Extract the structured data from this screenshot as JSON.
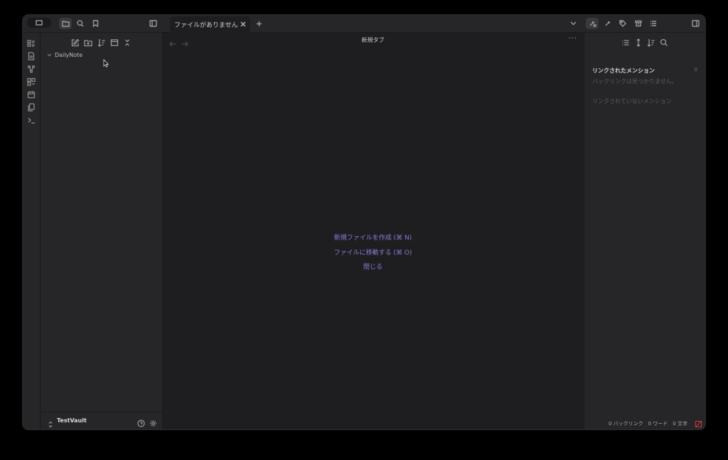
{
  "tab": {
    "title": "ファイルがありません"
  },
  "main": {
    "view_title": "新規タブ",
    "more_label": "···",
    "actions": {
      "new_file": "新規ファイルを作成 (⌘ N)",
      "go_to_file": "ファイルに移動する (⌘ O)",
      "close": "閉じる"
    }
  },
  "sidebar": {
    "folder": "DailyNote",
    "vault_name": "TestVault"
  },
  "backlinks": {
    "linked_heading": "リンクされたメンション",
    "linked_count": "0",
    "empty_message": "バックリンクは見つかりません。",
    "unlinked_heading": "リンクされていないメンション"
  },
  "status": {
    "backlinks": "0 バックリンク",
    "words": "0 ワード",
    "chars": "0 文字"
  },
  "colors": {
    "accent": "#8f79d6",
    "background": "#1e1e20",
    "panel": "#262628"
  }
}
